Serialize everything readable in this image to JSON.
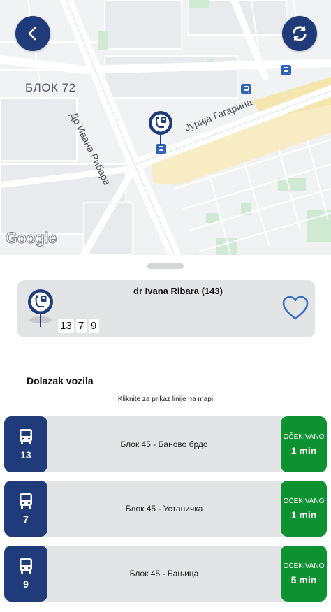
{
  "map": {
    "area_label": "БЛОК 72",
    "street_1": "Др Ивана Рибара",
    "street_2": "Јурија Гагарина",
    "logo_text": "Google",
    "back_icon": "chevron-left-icon",
    "refresh_icon": "refresh-icon"
  },
  "stop": {
    "name": "dr Ivana Ribara (143)",
    "lines": [
      "13",
      "7",
      "9"
    ],
    "favorite_icon": "heart-outline-icon"
  },
  "arrivals_section": {
    "title": "Dolazak vozila",
    "hint": "Kliknite za prikaz linije na mapi"
  },
  "arrivals": [
    {
      "line": "13",
      "route": "Блок 45 - Баново брдо",
      "status": "OČEKIVANO",
      "eta": "1 min"
    },
    {
      "line": "7",
      "route": "Блок 45 - Устаничка",
      "status": "OČEKIVANO",
      "eta": "1 min"
    },
    {
      "line": "9",
      "route": "Блок 45 - Бањица",
      "status": "OČEKIVANO",
      "eta": "5 min"
    }
  ],
  "colors": {
    "primary": "#1f3b7a",
    "eta_green": "#0e9130",
    "card_bg": "#e3e4e6",
    "transit_blue": "#2e62b8"
  }
}
